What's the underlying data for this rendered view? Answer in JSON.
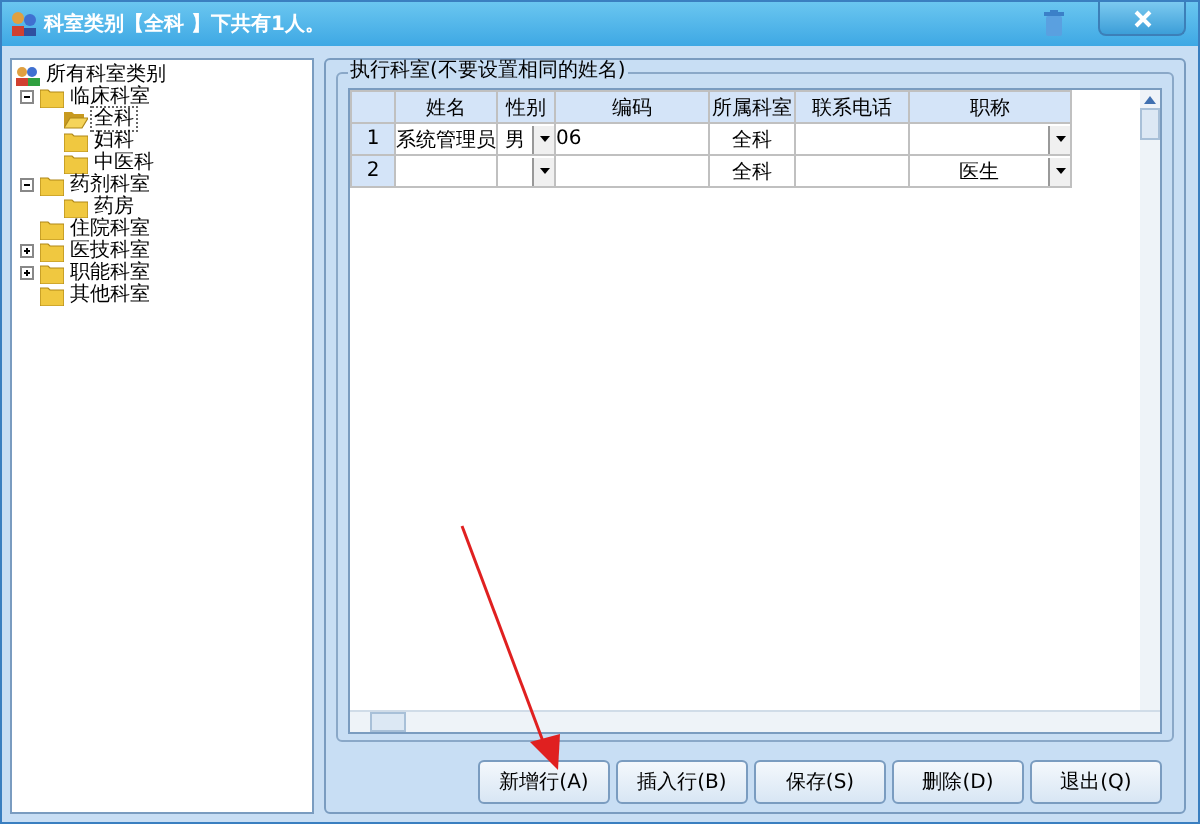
{
  "window": {
    "title": "科室类别【全科 】下共有1人。"
  },
  "tree": {
    "root": "所有科室类别",
    "children": [
      {
        "label": "临床科室",
        "expanded": true,
        "selected": false,
        "children": [
          {
            "label": "全科",
            "selected": true
          },
          {
            "label": "妇科",
            "selected": false
          },
          {
            "label": "中医科",
            "selected": false
          }
        ]
      },
      {
        "label": "药剂科室",
        "expanded": true,
        "selected": false,
        "children": [
          {
            "label": "药房",
            "selected": false
          }
        ]
      },
      {
        "label": "住院科室",
        "selected": false
      },
      {
        "label": "医技科室",
        "expanded": false,
        "selected": false
      },
      {
        "label": "职能科室",
        "expanded": false,
        "selected": false
      },
      {
        "label": "其他科室",
        "selected": false
      }
    ]
  },
  "group": {
    "title": "执行科室(不要设置相同的姓名)"
  },
  "table": {
    "columns": [
      {
        "label": "姓名",
        "dropdown": false
      },
      {
        "label": "性别",
        "dropdown": true
      },
      {
        "label": "编码",
        "dropdown": false
      },
      {
        "label": "所属科室",
        "dropdown": false
      },
      {
        "label": "联系电话",
        "dropdown": false
      },
      {
        "label": "职称",
        "dropdown": true
      }
    ],
    "rows": [
      {
        "number": "1",
        "cells": [
          "系统管理员",
          "男",
          "06",
          "全科",
          "",
          ""
        ]
      },
      {
        "number": "2",
        "cells": [
          "",
          "",
          "",
          "全科",
          "",
          "医生"
        ]
      }
    ]
  },
  "buttons": [
    "新增行(A)",
    "插入行(B)",
    "保存(S)",
    "删除(D)",
    "退出(Q)"
  ],
  "annotation": {
    "kind": "arrow"
  }
}
